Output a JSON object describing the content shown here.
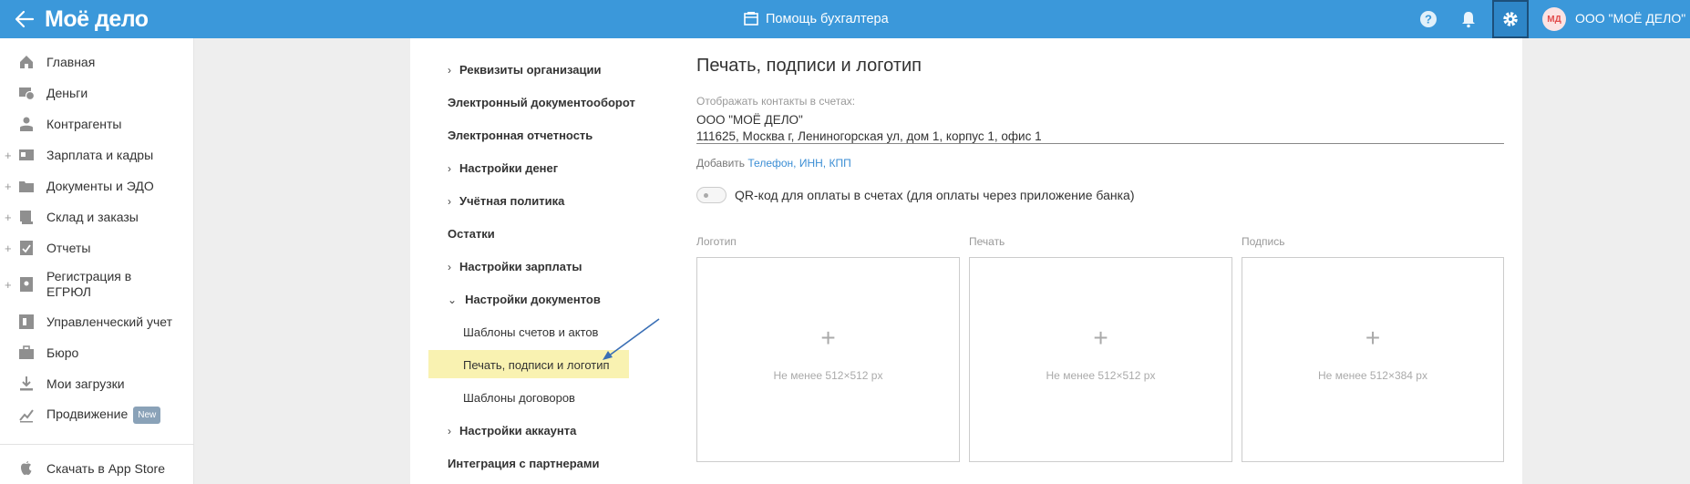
{
  "header": {
    "logo": "Моё дело",
    "help_label": "Помощь бухгалтера",
    "avatar_initials": "МД",
    "org_name": "ООО \"МОЁ ДЕЛО\"",
    "accent_color": "#3b98da"
  },
  "sidebar": {
    "items": [
      {
        "label": "Главная",
        "icon": "home-icon"
      },
      {
        "label": "Деньги",
        "icon": "money-icon"
      },
      {
        "label": "Контрагенты",
        "icon": "contractors-icon"
      },
      {
        "label": "Зарплата и кадры",
        "icon": "salary-icon"
      },
      {
        "label": "Документы и ЭДО",
        "icon": "documents-icon"
      },
      {
        "label": "Склад и заказы",
        "icon": "warehouse-icon"
      },
      {
        "label": "Отчеты",
        "icon": "reports-icon"
      },
      {
        "label": "Регистрация в ЕГРЮЛ",
        "icon": "registration-icon"
      },
      {
        "label": "Управленческий учет",
        "icon": "management-icon"
      },
      {
        "label": "Бюро",
        "icon": "bureau-icon"
      },
      {
        "label": "Мои загрузки",
        "icon": "download-icon"
      },
      {
        "label": "Продвижение",
        "icon": "promotion-icon",
        "badge": "New"
      }
    ],
    "appstore_label": "Скачать в App Store"
  },
  "settings_nav": {
    "items": [
      {
        "label": "Реквизиты организации",
        "chevron": "›"
      },
      {
        "label": "Электронный документооборот"
      },
      {
        "label": "Электронная отчетность"
      },
      {
        "label": "Настройки денег",
        "chevron": "›"
      },
      {
        "label": "Учётная политика",
        "chevron": "›"
      },
      {
        "label": "Остатки"
      },
      {
        "label": "Настройки зарплаты",
        "chevron": "›"
      },
      {
        "label": "Настройки документов",
        "chevron": "⌄"
      },
      {
        "label": "Шаблоны счетов и актов"
      },
      {
        "label": "Печать, подписи и логотип"
      },
      {
        "label": "Шаблоны договоров"
      },
      {
        "label": "Настройки аккаунта",
        "chevron": "›"
      },
      {
        "label": "Интеграция с партнерами"
      }
    ]
  },
  "main": {
    "title": "Печать, подписи и логотип",
    "contacts_label": "Отображать контакты в счетах:",
    "contacts_line1": "ООО \"МОЁ ДЕЛО\"",
    "contacts_line2": "111625, Москва г, Лениногорская ул, дом 1, корпус 1, офис 1",
    "add_prefix": "Добавить",
    "add_links": "Телефон, ИНН, КПП",
    "qr_label": "QR-код для оплаты в счетах (для оплаты через приложение банка)",
    "uploads": [
      {
        "label": "Логотип",
        "plus": "+",
        "hint": "Не менее 512×512 px"
      },
      {
        "label": "Печать",
        "plus": "+",
        "hint": "Не менее 512×512 px"
      },
      {
        "label": "Подпись",
        "plus": "+",
        "hint": "Не менее 512×384 px"
      }
    ]
  }
}
